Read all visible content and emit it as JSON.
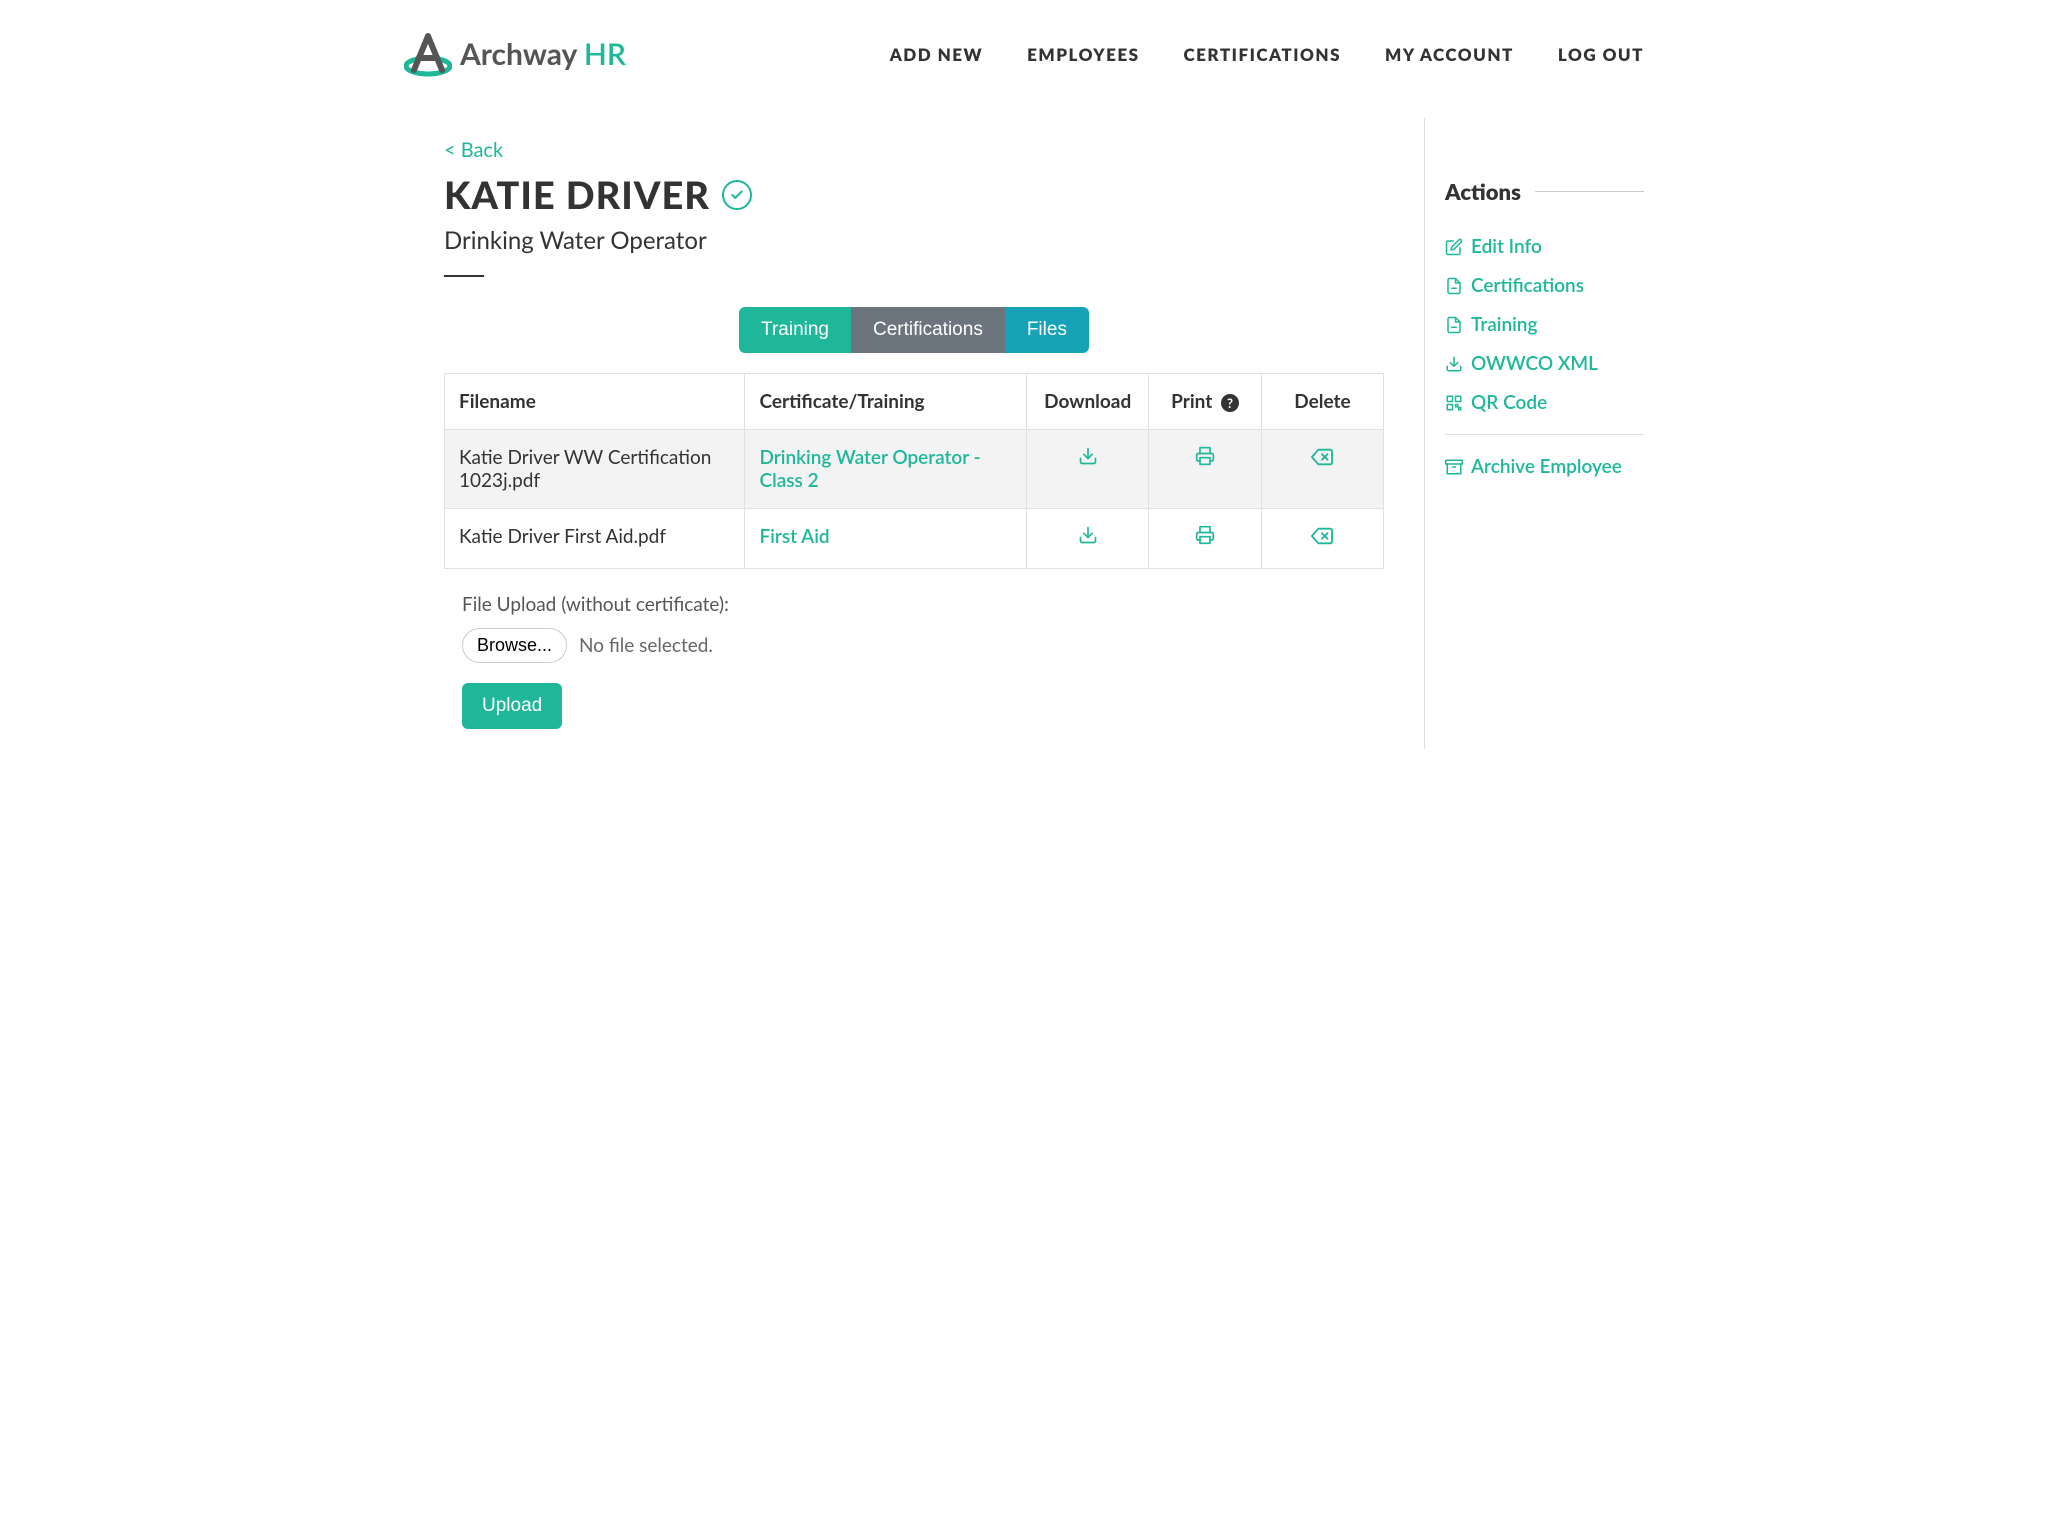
{
  "brand": {
    "name": "Archway",
    "suffix": "HR"
  },
  "nav": {
    "add_new": "Add New",
    "employees": "Employees",
    "certifications": "Certifications",
    "my_account": "My Account",
    "log_out": "Log Out"
  },
  "back_link": "< Back",
  "employee": {
    "name": "Katie Driver",
    "role": "Drinking Water Operator"
  },
  "tabs": {
    "training": "Training",
    "certifications": "Certifications",
    "files": "Files"
  },
  "table": {
    "headers": {
      "filename": "Filename",
      "cert": "Certificate/Training",
      "download": "Download",
      "print": "Print",
      "delete": "Delete"
    },
    "rows": [
      {
        "filename": "Katie Driver WW Certification 1023j.pdf",
        "cert": "Drinking Water Operator - Class 2"
      },
      {
        "filename": "Katie Driver First Aid.pdf",
        "cert": "First Aid"
      }
    ]
  },
  "upload": {
    "label": "File Upload (without certificate):",
    "browse": "Browse...",
    "status": "No file selected.",
    "button": "Upload"
  },
  "sidebar": {
    "title": "Actions",
    "edit_info": "Edit Info",
    "certifications": "Certifications",
    "training": "Training",
    "owwco": "OWWCO XML",
    "qr": "QR Code",
    "archive": "Archive Employee"
  }
}
